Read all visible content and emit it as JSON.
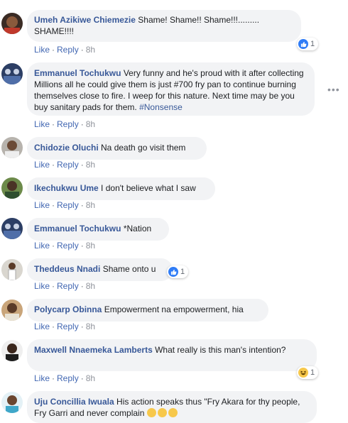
{
  "actions": {
    "like": "Like",
    "reply": "Reply",
    "separator": "·"
  },
  "comments": [
    {
      "author": "Umeh Azikiwe Chiemezie",
      "text": "Shame! Shame!! Shame!!!......... SHAME!!!!",
      "time": "8h",
      "reaction_count": "1"
    },
    {
      "author": "Emmanuel Tochukwu",
      "text": "Very funny and he's proud with it after collecting Millions all he could give them is just #700 fry pan to continue burning themselves close to fire. I weep for this nature. Next time may be you buy sanitary pads for them.",
      "hashtag": "#Nonsense",
      "time": "8h"
    },
    {
      "author": "Chidozie Oluchi",
      "text": "Na death go visit them",
      "time": "8h"
    },
    {
      "author": "Ikechukwu Ume",
      "text": "I don't believe what I saw",
      "time": "8h"
    },
    {
      "author": "Emmanuel Tochukwu",
      "text": "*Nation",
      "time": "8h"
    },
    {
      "author": "Theddeus Nnadi",
      "text": "Shame onto u",
      "time": "8h",
      "reaction_count": "1"
    },
    {
      "author": "Polycarp Obinna",
      "text": "Empowerment na empowerment, hia",
      "time": "8h"
    },
    {
      "author": "Maxwell Nnaemeka Lamberts",
      "text": "What really is this man's intention?",
      "time": "8h",
      "reaction_count": "1"
    },
    {
      "author": "Uju Concillia Iwuala",
      "text": "His action speaks thus \"Fry Akara for thy people, Fry Garri and never complain"
    }
  ],
  "colors": {
    "author": "#385898",
    "link": "#4267b2",
    "bubble": "#f2f3f5",
    "like_blue": "#2f7cf6",
    "haha_yellow": "#f7c84b"
  },
  "icons": [
    "like-reaction-icon",
    "haha-reaction-icon",
    "more-options-icon",
    "grinning-squinting-face-emoji"
  ]
}
